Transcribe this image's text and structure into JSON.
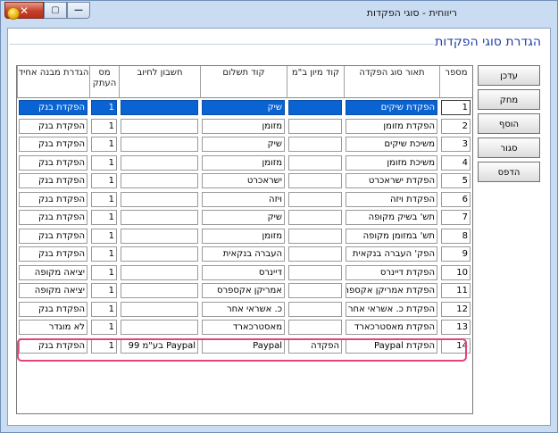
{
  "window": {
    "title": "ריווחית - סוגי הפקדות",
    "minimize_label": "—",
    "maximize_label": "▢",
    "close_label": "✕"
  },
  "page": {
    "heading": "הגדרת סוגי הפקדות"
  },
  "actions": [
    "עדכן",
    "מחק",
    "הוסף",
    "סגור",
    "הדפס"
  ],
  "table": {
    "columns": [
      "מספר",
      "תאור סוג הפקדה",
      "קוד מיון ב\"מ",
      "קוד תשלום",
      "חשבון לחיוב",
      "מס העתק",
      "הגדרת מבנה אחיד"
    ],
    "rows": [
      [
        "1",
        "הפקדת שיקים",
        "",
        "שיק",
        "",
        "1",
        "הפקדת בנק"
      ],
      [
        "2",
        "הפקדת מזומן",
        "",
        "מזומן",
        "",
        "1",
        "הפקדת בנק"
      ],
      [
        "3",
        "משיכת שיקים",
        "",
        "שיק",
        "",
        "1",
        "הפקדת בנק"
      ],
      [
        "4",
        "משיכת מזומן",
        "",
        "מזומן",
        "",
        "1",
        "הפקדת בנק"
      ],
      [
        "5",
        "הפקדת ישראכרט",
        "",
        "ישראכרט",
        "",
        "1",
        "הפקדת בנק"
      ],
      [
        "6",
        "הפקדת ויזה",
        "",
        "ויזה",
        "",
        "1",
        "הפקדת בנק"
      ],
      [
        "7",
        "תש' בשיק מקופה",
        "",
        "שיק",
        "",
        "1",
        "הפקדת בנק"
      ],
      [
        "8",
        "תש' במזומן מקופה",
        "",
        "מזומן",
        "",
        "1",
        "הפקדת בנק"
      ],
      [
        "9",
        "הפק' העברה בנקאית",
        "",
        "העברה בנקאית",
        "",
        "1",
        "הפקדת בנק"
      ],
      [
        "10",
        "הפקדת דיינרס",
        "",
        "דיינרס",
        "",
        "1",
        "יציאה מקופה"
      ],
      [
        "11",
        "הפקדת אמריקן אקספר",
        "",
        "אמריקן אקספרס",
        "",
        "1",
        "יציאה מקופה"
      ],
      [
        "12",
        "הפקדת כ. אשראי אחר",
        "",
        "כ. אשראי אחר",
        "",
        "1",
        "הפקדת בנק"
      ],
      [
        "13",
        "הפקדת מאסטרכארד",
        "",
        "מאסטרכארד",
        "",
        "1",
        "לא מוגדר"
      ],
      [
        "14",
        "הפקדת Paypal",
        "הפקדה",
        "Paypal",
        "Paypal בע\"מ 99",
        "1",
        "הפקדת בנק"
      ]
    ],
    "selected_row": 0,
    "highlighted_row": 13
  },
  "colors": {
    "selection": "#0a63d2",
    "highlight": "#e0457a",
    "heading": "#1f3fa8"
  }
}
